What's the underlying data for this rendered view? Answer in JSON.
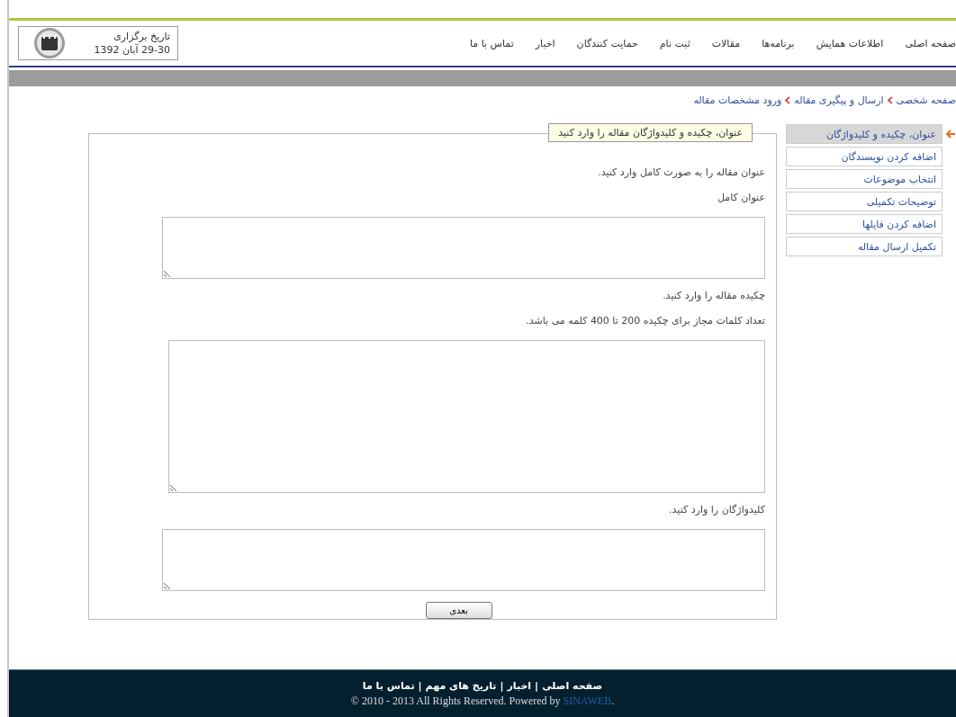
{
  "header": {
    "date_box": {
      "label": "تاریخ برگزاری",
      "date": "29-30 آبان 1392"
    },
    "nav": [
      {
        "label": "صفحه اصلی"
      },
      {
        "label": "اطلاعات همایش"
      },
      {
        "label": "برنامه‌ها"
      },
      {
        "label": "مقالات"
      },
      {
        "label": "ثبت نام"
      },
      {
        "label": "حمایت کنندگان"
      },
      {
        "label": "اخبار"
      },
      {
        "label": "تماس با ما"
      }
    ]
  },
  "breadcrumb": [
    {
      "label": "صفحه شخصی"
    },
    {
      "label": "ارسال و پیگیری مقاله"
    },
    {
      "label": "ورود مشخصات مقاله"
    }
  ],
  "steps": [
    {
      "label": "عنوان، چکیده و کلیدواژگان",
      "selected": true
    },
    {
      "label": "اضافه کردن نویسندگان",
      "selected": false
    },
    {
      "label": "انتخاب موضوعات",
      "selected": false
    },
    {
      "label": "توضیحات تکمیلی",
      "selected": false
    },
    {
      "label": "اضافه کردن فایلها",
      "selected": false
    },
    {
      "label": "تکمیل ارسال مقاله",
      "selected": false
    }
  ],
  "form": {
    "legend": "عنوان، چکیده و کلیدواژگان مقاله را وارد کنید",
    "sections": [
      {
        "notes": [
          "عنوان مقاله را به صورت کامل وارد کنید.",
          "عنوان کامل"
        ],
        "kind": "short"
      },
      {
        "notes": [
          "چکیده مقاله را وارد کنید.",
          "تعداد کلمات مجاز برای چکیده 200 تا 400 کلمه می باشد."
        ],
        "kind": "tall"
      },
      {
        "notes": [
          "کلیدواژگان را وارد کنید."
        ],
        "kind": "short"
      }
    ],
    "next_button": "بعدی"
  },
  "footer": {
    "links": [
      "صفحه اصلی",
      "اخبار",
      "تاریخ های مهم",
      "تماس با ما"
    ],
    "separator": "|",
    "copyright": "© 2010 - 2013 All Rights Reserved. Powered by",
    "powered_link": "SINAWEB",
    "end": "."
  }
}
